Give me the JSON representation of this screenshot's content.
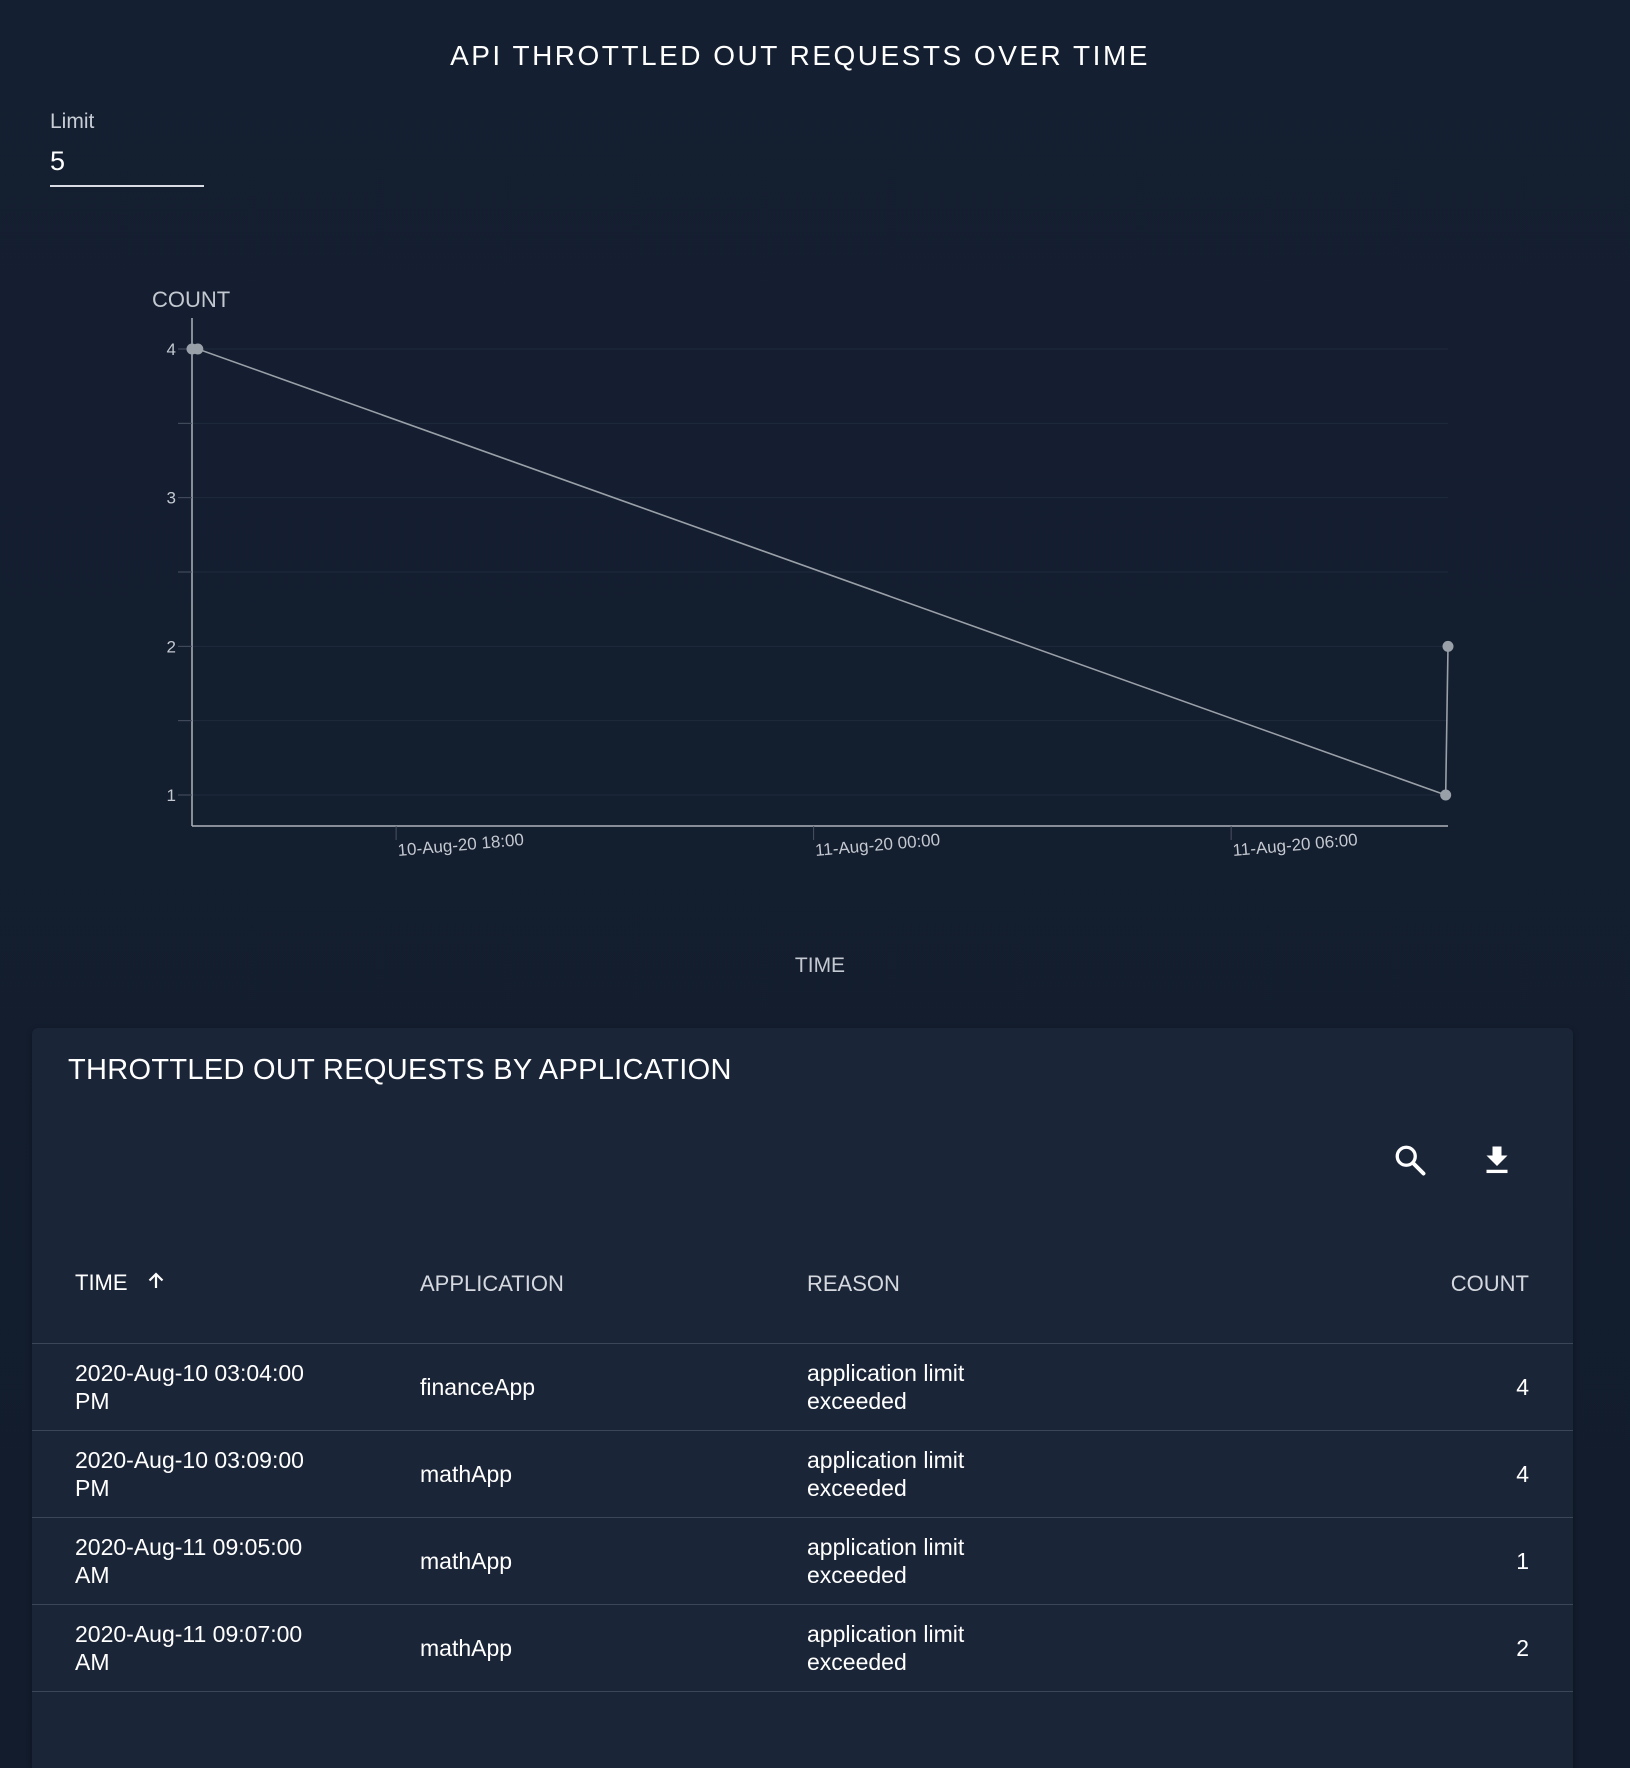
{
  "chart_title": "API THROTTLED OUT REQUESTS OVER TIME",
  "limit": {
    "label": "Limit",
    "value": "5"
  },
  "chart_data": {
    "type": "line",
    "title": "API THROTTLED OUT REQUESTS OVER TIME",
    "xlabel": "TIME",
    "ylabel": "COUNT",
    "x_ticks": [
      "10-Aug-20 18:00",
      "11-Aug-20 00:00",
      "11-Aug-20 06:00"
    ],
    "y_ticks": [
      1,
      2,
      3,
      4
    ],
    "ylim": [
      0.8,
      4
    ],
    "xlim": [
      "2020-08-10 15:04",
      "2020-08-11 09:07"
    ],
    "grid": true,
    "series": [
      {
        "points": [
          {
            "x": "2020-08-10 15:04",
            "y": 4
          },
          {
            "x": "2020-08-10 15:09",
            "y": 4
          },
          {
            "x": "2020-08-11 09:05",
            "y": 1
          },
          {
            "x": "2020-08-11 09:07",
            "y": 2
          }
        ],
        "color": "#9aa0a8"
      }
    ]
  },
  "table": {
    "title": "THROTTLED OUT REQUESTS BY APPLICATION",
    "toolbar": {
      "search_icon": "search-icon",
      "download_icon": "download-icon"
    },
    "columns": {
      "time": "TIME",
      "application": "APPLICATION",
      "reason": "REASON",
      "count": "COUNT"
    },
    "rows": [
      {
        "time_a": "2020-Aug-10 03:04:00",
        "time_b": "PM",
        "application": "financeApp",
        "reason_a": "application limit",
        "reason_b": "exceeded",
        "count": "4"
      },
      {
        "time_a": "2020-Aug-10 03:09:00",
        "time_b": "PM",
        "application": "mathApp",
        "reason_a": "application limit",
        "reason_b": "exceeded",
        "count": "4"
      },
      {
        "time_a": "2020-Aug-11 09:05:00",
        "time_b": "AM",
        "application": "mathApp",
        "reason_a": "application limit",
        "reason_b": "exceeded",
        "count": "1"
      },
      {
        "time_a": "2020-Aug-11 09:07:00",
        "time_b": "AM",
        "application": "mathApp",
        "reason_a": "application limit",
        "reason_b": "exceeded",
        "count": "2"
      }
    ]
  },
  "colors": {
    "background": "#141f30",
    "card": "#1b2538",
    "line": "#9aa0a8"
  }
}
